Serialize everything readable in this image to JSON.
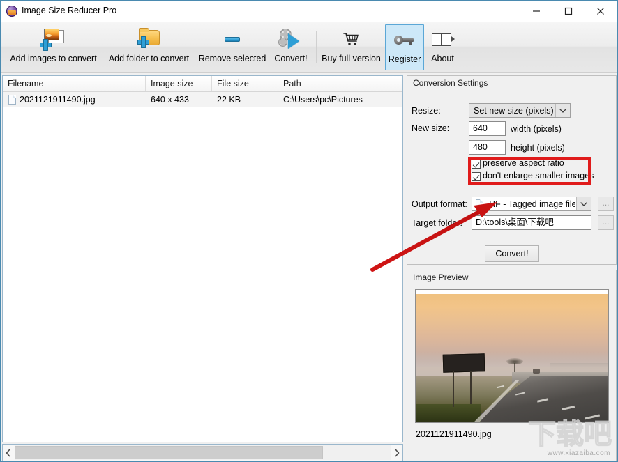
{
  "window": {
    "title": "Image Size Reducer Pro",
    "app_icon": "app-logo-icon",
    "minimize": "minimize-icon",
    "maximize": "maximize-icon",
    "close": "close-icon"
  },
  "toolbar": {
    "buttons": [
      {
        "label": "Add images to convert",
        "icon": "add-images-icon",
        "selected": false
      },
      {
        "label": "Add folder to convert",
        "icon": "add-folder-icon",
        "selected": false
      },
      {
        "label": "Remove selected",
        "icon": "remove-icon",
        "selected": false
      },
      {
        "label": "Convert!",
        "icon": "convert-gears-icon",
        "selected": false
      },
      {
        "label": "Buy full version",
        "icon": "shopping-cart-icon",
        "selected": false
      },
      {
        "label": "Register",
        "icon": "key-icon",
        "selected": true
      },
      {
        "label": "About",
        "icon": "book-icon",
        "selected": false
      }
    ]
  },
  "file_list": {
    "columns": [
      "Filename",
      "Image size",
      "File size",
      "Path"
    ],
    "rows": [
      {
        "filename": "2021121911490.jpg",
        "image_size": "640 x 433",
        "file_size": "22 KB",
        "path": "C:\\Users\\pc\\Pictures",
        "icon": "file-icon"
      }
    ]
  },
  "scrollbar": {
    "left_arrow": "chevron-left-icon",
    "right_arrow": "chevron-right-icon"
  },
  "settings": {
    "title": "Conversion Settings",
    "resize_label": "Resize:",
    "resize_value": "Set new size (pixels)",
    "new_size_label": "New size:",
    "width_value": "640",
    "width_suffix": "width  (pixels)",
    "height_value": "480",
    "height_suffix": "height (pixels)",
    "preserve_aspect_label": "preserve aspect ratio",
    "preserve_aspect_checked": true,
    "dont_enlarge_label": "don't enlarge smaller images",
    "dont_enlarge_checked": true,
    "output_format_label": "Output format:",
    "output_format_value": "TIF - Tagged image file",
    "output_format_browse": "...",
    "target_folder_label": "Target folder:",
    "target_folder_value": "D:\\tools\\桌面\\下载吧",
    "target_folder_browse": "...",
    "convert_button": "Convert!"
  },
  "preview": {
    "title": "Image Preview",
    "filename": "2021121911490.jpg",
    "image_description": "foggy-sunrise-highway-with-blank-billboard"
  },
  "annotations": {
    "highlight_color": "#e01b1b",
    "rect_target": "checkbox-group",
    "arrow_target": "output-format-combo"
  },
  "watermark": {
    "cjk": "下载吧",
    "url": "www.xiazaiba.com"
  }
}
